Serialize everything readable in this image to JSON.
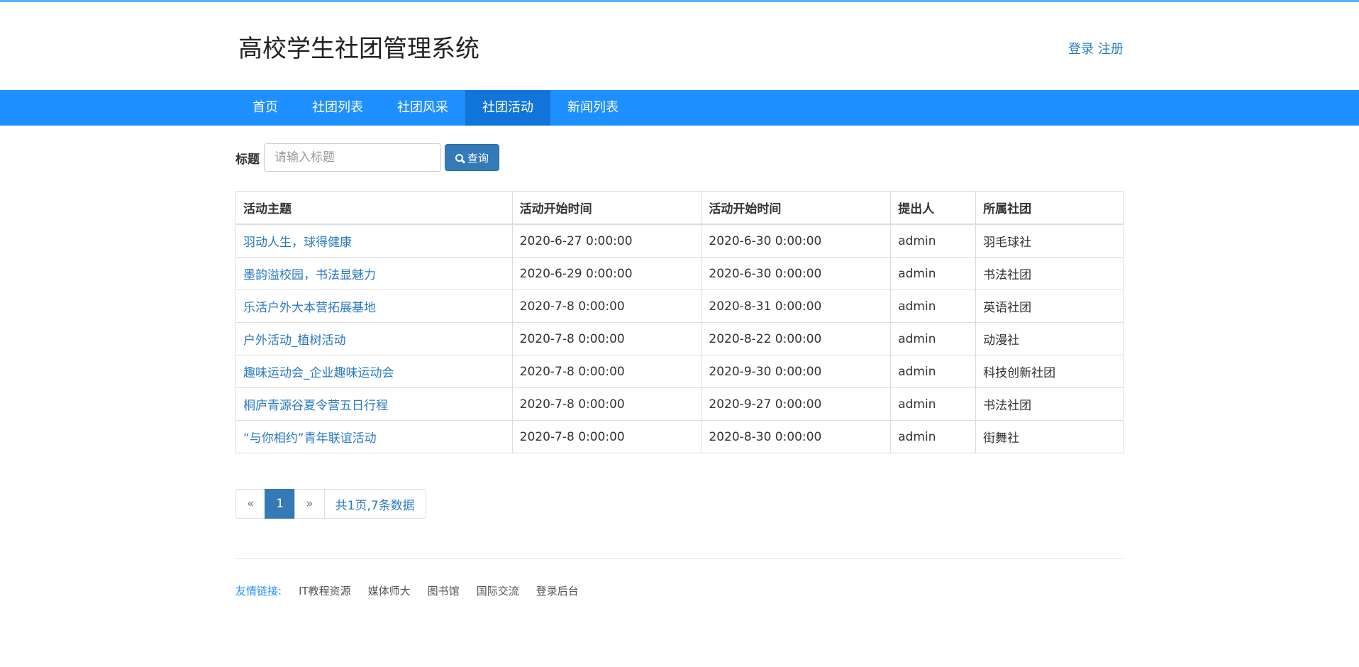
{
  "header": {
    "title": "高校学生社团管理系统",
    "login": "登录",
    "register": "注册"
  },
  "nav": {
    "items": [
      "首页",
      "社团列表",
      "社团风采",
      "社团活动",
      "新闻列表"
    ],
    "active_index": 3
  },
  "search": {
    "label": "标题",
    "placeholder": "请输入标题",
    "button": "查询"
  },
  "table": {
    "headers": [
      "活动主题",
      "活动开始时间",
      "活动开始时间",
      "提出人",
      "所属社团"
    ],
    "rows": [
      [
        "羽动人生，球得健康",
        "2020-6-27 0:00:00",
        "2020-6-30 0:00:00",
        "admin",
        "羽毛球社"
      ],
      [
        "墨韵溢校园，书法显魅力",
        "2020-6-29 0:00:00",
        "2020-6-30 0:00:00",
        "admin",
        "书法社团"
      ],
      [
        "乐活户外大本营拓展基地",
        "2020-7-8 0:00:00",
        "2020-8-31 0:00:00",
        "admin",
        "英语社团"
      ],
      [
        "户外活动_植树活动",
        "2020-7-8 0:00:00",
        "2020-8-22 0:00:00",
        "admin",
        "动漫社"
      ],
      [
        "趣味运动会_企业趣味运动会",
        "2020-7-8 0:00:00",
        "2020-9-30 0:00:00",
        "admin",
        "科技创新社团"
      ],
      [
        "桐庐青源谷夏令营五日行程",
        "2020-7-8 0:00:00",
        "2020-9-27 0:00:00",
        "admin",
        "书法社团"
      ],
      [
        "“与你相约”青年联谊活动",
        "2020-7-8 0:00:00",
        "2020-8-30 0:00:00",
        "admin",
        "街舞社"
      ]
    ]
  },
  "pagination": {
    "prev": "«",
    "current": "1",
    "next": "»",
    "info": "共1页,7条数据"
  },
  "footer": {
    "label": "友情链接:",
    "links": [
      "IT教程资源",
      "媒体师大",
      "图书馆",
      "国际交流",
      "登录后台"
    ]
  },
  "colors": {
    "nav_bg": "#1e8fff",
    "nav_active": "#1174db",
    "link": "#2a7ac0",
    "button": "#337ab7"
  }
}
